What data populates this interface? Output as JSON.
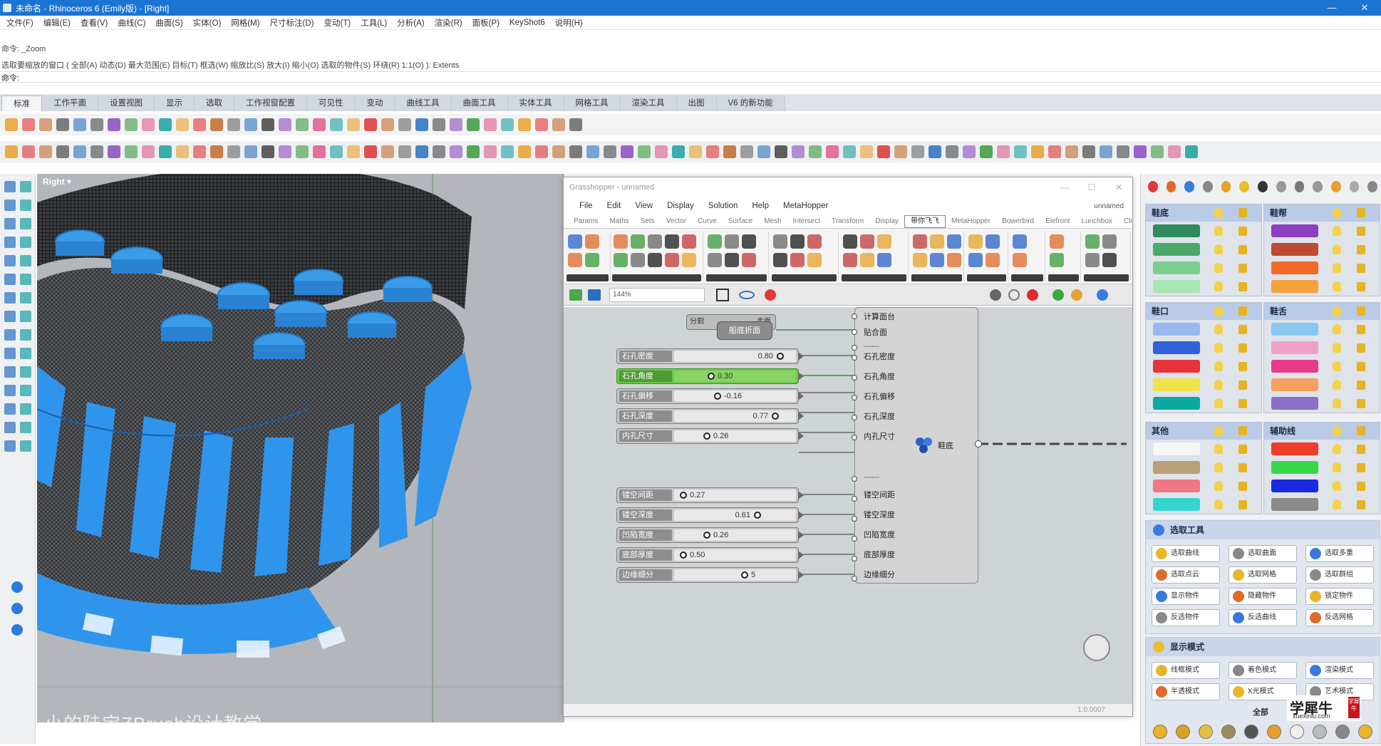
{
  "window": {
    "title": "未命名 - Rhinoceros 6 (Emily版) - [Right]",
    "minimize": "—",
    "close": "✕"
  },
  "rhino_menu": [
    "文件(F)",
    "编辑(E)",
    "查看(V)",
    "曲线(C)",
    "曲面(S)",
    "实体(O)",
    "网格(M)",
    "尺寸标注(D)",
    "变动(T)",
    "工具(L)",
    "分析(A)",
    "渲染(R)",
    "面板(P)",
    "KeyShot6",
    "说明(H)"
  ],
  "command_history": {
    "line1": "命令: _Zoom",
    "line2": "选取要缩放的窗口 ( 全部(A) 动态(D) 最大范围(E) 目标(T) 框选(W) 缩放比(S) 放大(I) 缩小(O) 选取的物件(S) 环绕(R) 1:1(O) ): Extents",
    "prompt": "命令:"
  },
  "ribbon_tabs": [
    "标准",
    "工作平面",
    "设置视图",
    "显示",
    "选取",
    "工作视窗配置",
    "可见性",
    "变动",
    "曲线工具",
    "曲面工具",
    "实体工具",
    "网格工具",
    "渲染工具",
    "出图",
    "V6 的新功能"
  ],
  "viewport": {
    "label": "Right ▾",
    "caption": "小的陆宝ZBrush设计教学"
  },
  "grasshopper": {
    "title": "Grasshopper - unnamed",
    "menu": [
      "File",
      "Edit",
      "View",
      "Display",
      "Solution",
      "Help",
      "MetaHopper"
    ],
    "file_name": "unnamed",
    "tabs": [
      "Params",
      "Maths",
      "Sets",
      "Vector",
      "Curve",
      "Surface",
      "Mesh",
      "Intersect",
      "Transform",
      "Display",
      "带你飞飞",
      "MetaHopper",
      "Bowerbird",
      "Elefront",
      "Lunchbox",
      "Clipper"
    ],
    "active_tab_index": 10,
    "zoom": "144%",
    "status": "1.0.0007",
    "cluster_label": "分割",
    "cluster_end": "走面",
    "tooltip": "船底折面",
    "component_name": "鞋底",
    "sliders": [
      {
        "label": "石孔密度",
        "value": "0.80",
        "knob_position": 0.92,
        "active": false
      },
      {
        "label": "石孔角度",
        "value": "0.30",
        "knob_position": 0.3,
        "active": true
      },
      {
        "label": "石孔偏移",
        "value": "-0.16",
        "knob_position": 0.36,
        "active": false
      },
      {
        "label": "石孔深度",
        "value": "0.77",
        "knob_position": 0.88,
        "active": false
      },
      {
        "label": "内孔尺寸",
        "value": "0.26",
        "knob_position": 0.26,
        "active": false
      },
      {
        "label": "镂空间距",
        "value": "0.27",
        "knob_position": 0.05,
        "active": false
      },
      {
        "label": "镂空深度",
        "value": "0.61",
        "knob_position": 0.72,
        "active": false
      },
      {
        "label": "凹陷宽度",
        "value": "0.26",
        "knob_position": 0.26,
        "active": false
      },
      {
        "label": "底部厚度",
        "value": "0.50",
        "knob_position": 0.05,
        "active": false
      },
      {
        "label": "边缘细分",
        "value": "5",
        "knob_position": 0.6,
        "active": false
      }
    ],
    "inputs_top": [
      "计算面台",
      "贴合面"
    ],
    "inputs_mid": [
      "石孔密度",
      "石孔角度",
      "石孔偏移",
      "石孔深度",
      "内孔尺寸"
    ],
    "inputs_bottom": [
      "镂空间距",
      "镂空深度",
      "凹陷宽度",
      "底部厚度",
      "边缘细分"
    ],
    "separator": "------"
  },
  "layers": {
    "groups": [
      {
        "name": "鞋底",
        "colors": [
          "#2f8a5c",
          "#4aa86a",
          "#7cd08e",
          "#a8e6b4"
        ]
      },
      {
        "name": "鞋帮",
        "colors": [
          "#8a3fc0",
          "#c04a32",
          "#f06a28",
          "#f6a23a"
        ]
      },
      {
        "name": "鞋口",
        "colors": [
          "#9ab8f0",
          "#2f62d8",
          "#e8323a",
          "#f0e24a",
          "#0aa8a0"
        ]
      },
      {
        "name": "鞋舌",
        "colors": [
          "#86c8f0",
          "#f0a0c8",
          "#e83a8a",
          "#f6a060",
          "#8870c8"
        ]
      },
      {
        "name": "其他",
        "colors": [
          "#f6f6f6",
          "#b8a078",
          "#f07880",
          "#36d6d0"
        ]
      },
      {
        "name": "辅助线",
        "colors": [
          "#f03a2a",
          "#3ad64a",
          "#1a2ae0",
          "#8a8a8a"
        ]
      }
    ],
    "select_tools": {
      "title": "选取工具",
      "buttons": [
        "选取曲线",
        "选取曲面",
        "选取多重",
        "选取点云",
        "选取网格",
        "选取群组",
        "显示物件",
        "隐藏物件",
        "锁定物件",
        "反选物件",
        "反选曲线",
        "反选网格"
      ]
    },
    "display_modes": {
      "title": "显示模式",
      "buttons": [
        "线框模式",
        "着色模式",
        "渲染模式",
        "半透模式",
        "X光模式",
        "艺术模式"
      ],
      "all_label": "全部"
    }
  },
  "watermark": {
    "main": "学犀牛",
    "url": "xuexiniu.com",
    "seal": "学犀牛"
  }
}
